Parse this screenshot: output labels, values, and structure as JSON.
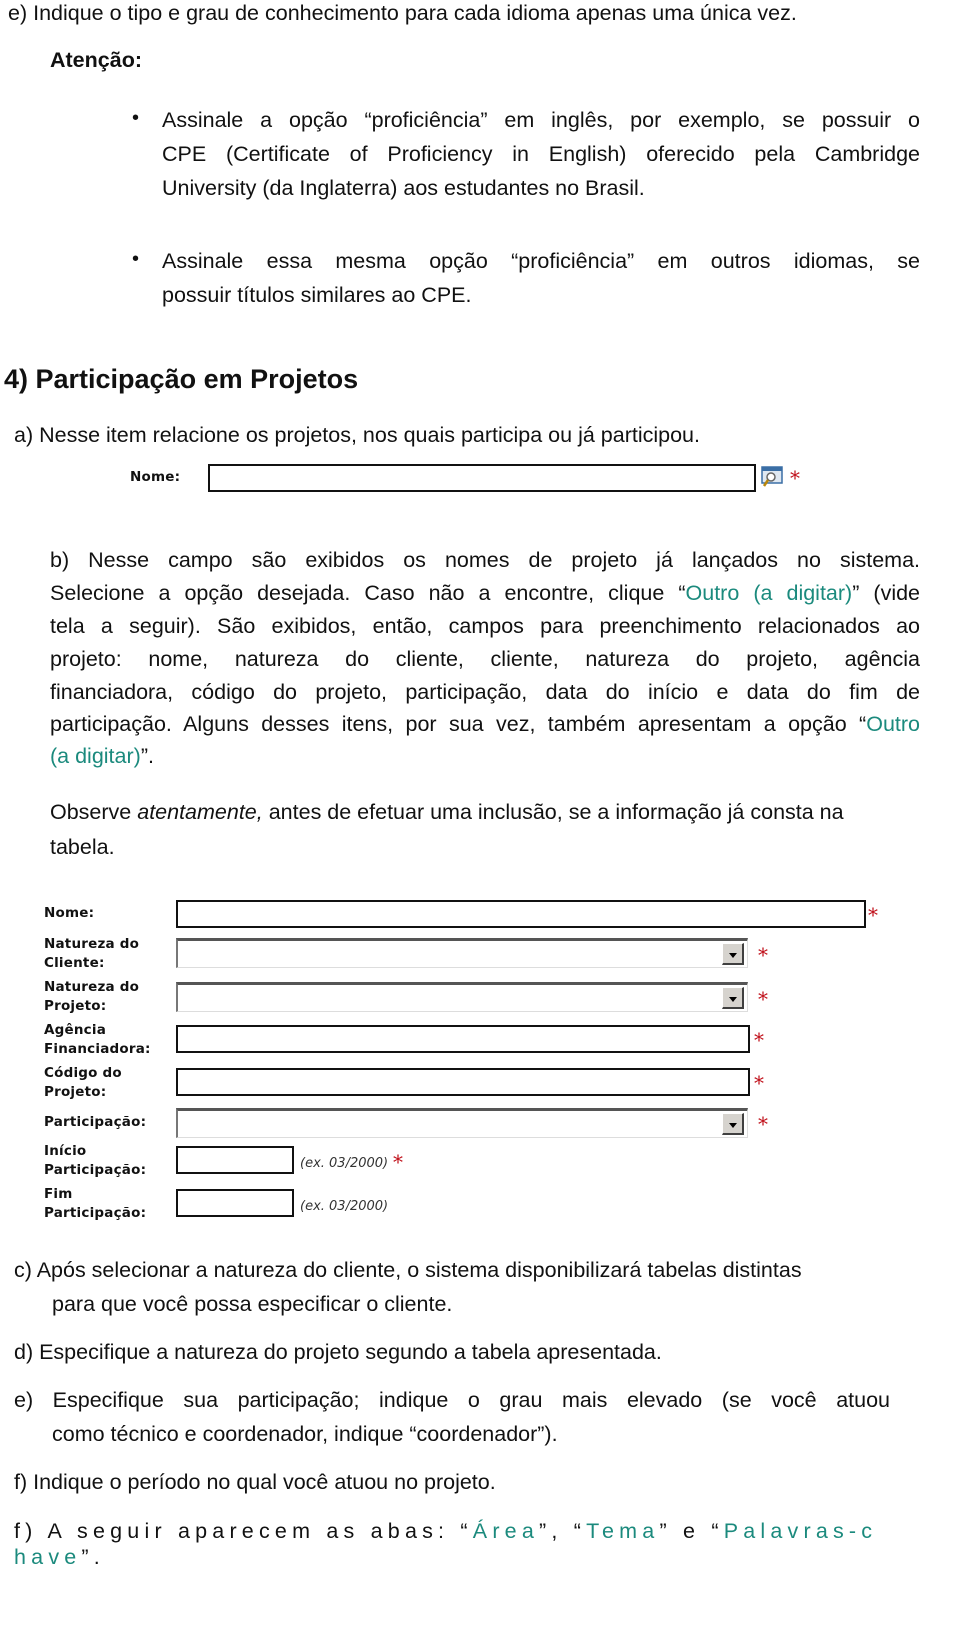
{
  "intro": {
    "item_e": "e) Indique o tipo e grau de conhecimento para cada idioma apenas uma única vez.",
    "attention_label": "Atenção:",
    "bullets": [
      {
        "lines": [
          "Assinale a opção “proficiência” em inglês, por exemplo, se possuir o",
          "CPE (Certificate of Proficiency in English) oferecido pela Cambridge",
          "University (da Inglaterra) aos estudantes no Brasil."
        ]
      },
      {
        "lines": [
          "Assinale essa mesma opção “proficiência” em outros idiomas, se",
          "possuir títulos similares ao CPE."
        ]
      }
    ]
  },
  "section4": {
    "title": "4) Participação em Projetos",
    "item_a": "a)  Nesse item relacione os projetos, nos quais participa ou já participou.",
    "search_form": {
      "label": "Nome:",
      "value": "",
      "required_mark": "*"
    },
    "item_b": {
      "line1": "b) Nesse campo são exibidos os nomes de projeto já lançados no sistema.",
      "line2_pre": "Selecione a opção desejada. Caso não a encontre, clique “",
      "line2_link": "Outro (a digitar)",
      "line2_post": "” (vide",
      "line3": "tela a seguir). São exibidos, então, campos para preenchimento relacionados ao",
      "line4": "projeto: nome, natureza do cliente, cliente, natureza do projeto, agência",
      "line5": "financiadora, código do projeto, participação, data do início e data do fim de",
      "line6_pre": "participação. Alguns desses itens, por sua vez, também apresentam a opção “",
      "line6_link": "Outro",
      "line7_link": "(a digitar)",
      "line7_post": "”."
    },
    "observe": {
      "pre": "Observe ",
      "em": "atentamente,",
      "post": " antes de efetuar uma inclusão, se a informação já consta na",
      "line2": "tabela."
    },
    "form": {
      "required_mark": "*",
      "fields": [
        {
          "label_lines": [
            "Nome:"
          ],
          "value": ""
        },
        {
          "label_lines": [
            "Natureza do",
            "Cliente:"
          ],
          "selected": ""
        },
        {
          "label_lines": [
            "Natureza do",
            "Projeto:"
          ],
          "selected": ""
        },
        {
          "label_lines": [
            "Agência",
            "Financiadora:"
          ],
          "value": ""
        },
        {
          "label_lines": [
            "Código do",
            "Projeto:"
          ],
          "value": ""
        },
        {
          "label_lines": [
            "Participação:"
          ],
          "selected": ""
        },
        {
          "label_lines": [
            "Início",
            "Participação:"
          ],
          "value": "",
          "hint": "(ex. 03/2000)"
        },
        {
          "label_lines": [
            "Fim",
            "Participação:"
          ],
          "value": "",
          "hint": "(ex. 03/2000)"
        }
      ]
    },
    "item_c": [
      "c)  Após selecionar a natureza do cliente, o sistema disponibilizará tabelas distintas",
      "para que você possa especificar o cliente."
    ],
    "item_d": "d)  Especifique a natureza do projeto segundo a tabela apresentada.",
    "item_e": [
      "e)  Especifique sua participação; indique o grau mais elevado (se você atuou",
      "como técnico e coordenador, indique “coordenador”)."
    ],
    "item_f": "f)  Indique o período no qual você atuou no projeto.",
    "item_f2": {
      "pre": "f) A seguir aparecem as abas: “",
      "tab1": "Área",
      "mid1": "”, “",
      "tab2": "Tema",
      "mid2": "” e “",
      "tab3_part1": "Palavras-c",
      "tab3_part2": "have",
      "post": "”."
    }
  }
}
